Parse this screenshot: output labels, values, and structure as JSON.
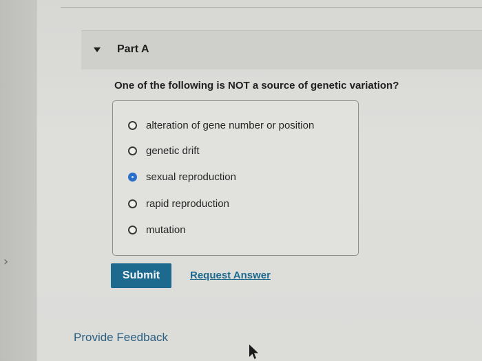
{
  "part": {
    "title": "Part A"
  },
  "question": {
    "text": "One of the following is NOT a source of genetic variation?"
  },
  "options": [
    {
      "label": "alteration of gene number or position",
      "selected": false
    },
    {
      "label": "genetic drift",
      "selected": false
    },
    {
      "label": "sexual reproduction",
      "selected": true
    },
    {
      "label": "rapid reproduction",
      "selected": false
    },
    {
      "label": "mutation",
      "selected": false
    }
  ],
  "actions": {
    "submit_label": "Submit",
    "request_answer_label": "Request Answer"
  },
  "footer": {
    "feedback_label": "Provide Feedback"
  },
  "icons": {
    "collapse": "caret-down-icon",
    "side": "chevron-right-icon",
    "pointer": "mouse-pointer-icon"
  },
  "colors": {
    "accent": "#1e6a8e",
    "radio_selected": "#2a6fc9"
  }
}
